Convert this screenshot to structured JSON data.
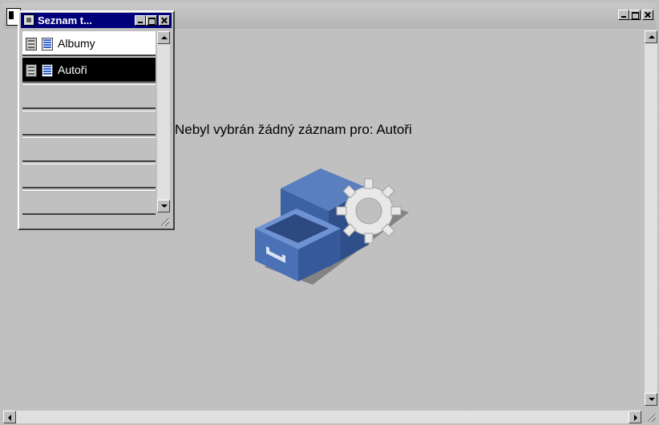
{
  "main_window": {
    "title": "",
    "message": "Nebyl vybrán žádný záznam pro: Autoři"
  },
  "list_window": {
    "title": "Seznam t...",
    "items": [
      {
        "label": "Albumy",
        "selected": false
      },
      {
        "label": "Autoři",
        "selected": true
      }
    ]
  },
  "colors": {
    "active_titlebar": "#00007b",
    "window_face": "#c0c0c0",
    "selection": "#000000"
  },
  "icons": [
    "app-icon",
    "table-icon",
    "form-icon",
    "drawer-gear-illustration"
  ]
}
